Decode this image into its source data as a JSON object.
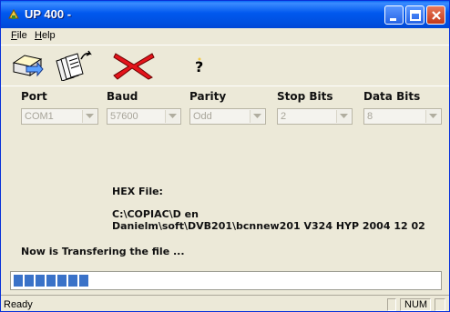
{
  "window": {
    "title": "UP 400 -"
  },
  "menu": {
    "items": [
      {
        "label": "File",
        "key": "F",
        "rest": "ile"
      },
      {
        "label": "Help",
        "key": "H",
        "rest": "elp"
      }
    ]
  },
  "toolbar": {
    "tools": [
      "send-icon",
      "open-files-icon",
      "cancel-icon",
      "help-icon"
    ]
  },
  "settings": {
    "port": {
      "label": "Port",
      "value": "COM1"
    },
    "baud": {
      "label": "Baud",
      "value": "57600"
    },
    "parity": {
      "label": "Parity",
      "value": "Odd"
    },
    "stop_bits": {
      "label": "Stop Bits",
      "value": "2"
    },
    "data_bits": {
      "label": "Data Bits",
      "value": "8"
    }
  },
  "file_info": {
    "heading": "HEX File:",
    "path_line1": "C:\\COPIAC\\D en",
    "path_line2": "Danielm\\soft\\DVB201\\bcnnew201  V324  HYP  2004  12  02"
  },
  "status_message": "Now is Transfering the file ...",
  "progress": {
    "filled_segments": 7,
    "segment_color": "#3a72c8"
  },
  "statusbar": {
    "text": "Ready",
    "num_indicator": "NUM"
  },
  "colors": {
    "titlebar": "#0058ee",
    "close_button": "#c3391a",
    "face": "#ece9d8"
  }
}
